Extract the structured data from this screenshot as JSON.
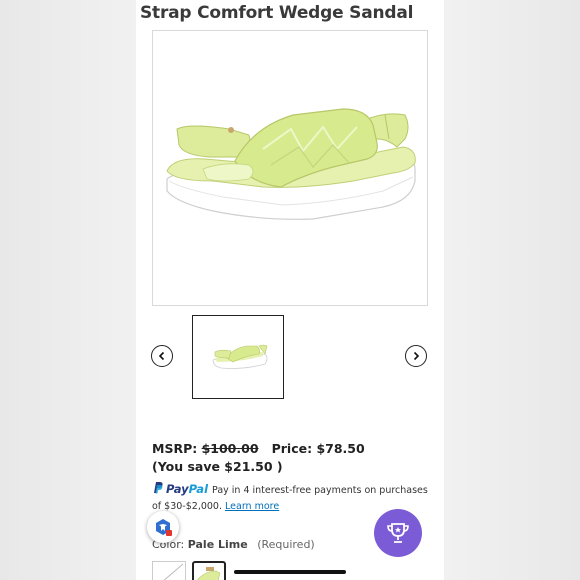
{
  "product": {
    "title": "Strap Comfort Wedge Sandal",
    "main_image_alt": "Pale lime strap comfort wedge sandal",
    "thumbnail_alt": "Sandal thumbnail"
  },
  "pricing": {
    "msrp_label": "MSRP:",
    "msrp_value": "$100.00",
    "price_label": "Price:",
    "price_value": "$78.50",
    "savings_text": "(You save $21.50 )"
  },
  "paypal": {
    "brand_pay": "Pay",
    "brand_pal": "Pal",
    "message": "Pay in 4 interest-free payments on purchases of $30-$2,000.",
    "learn_more": "Learn more"
  },
  "options": {
    "color_label": "Color:",
    "color_value": "Pale Lime",
    "required_text": "(Required)"
  },
  "colors": {
    "accent_purple": "#7b5cd6",
    "sandal_lime": "#dcec9a",
    "paypal_dark": "#253b80",
    "paypal_light": "#179bd7",
    "link_blue": "#0070ba"
  },
  "icons": {
    "prev": "chevron-left-icon",
    "next": "chevron-right-icon",
    "reward": "trophy-icon",
    "accessibility": "accessibility-icon"
  }
}
